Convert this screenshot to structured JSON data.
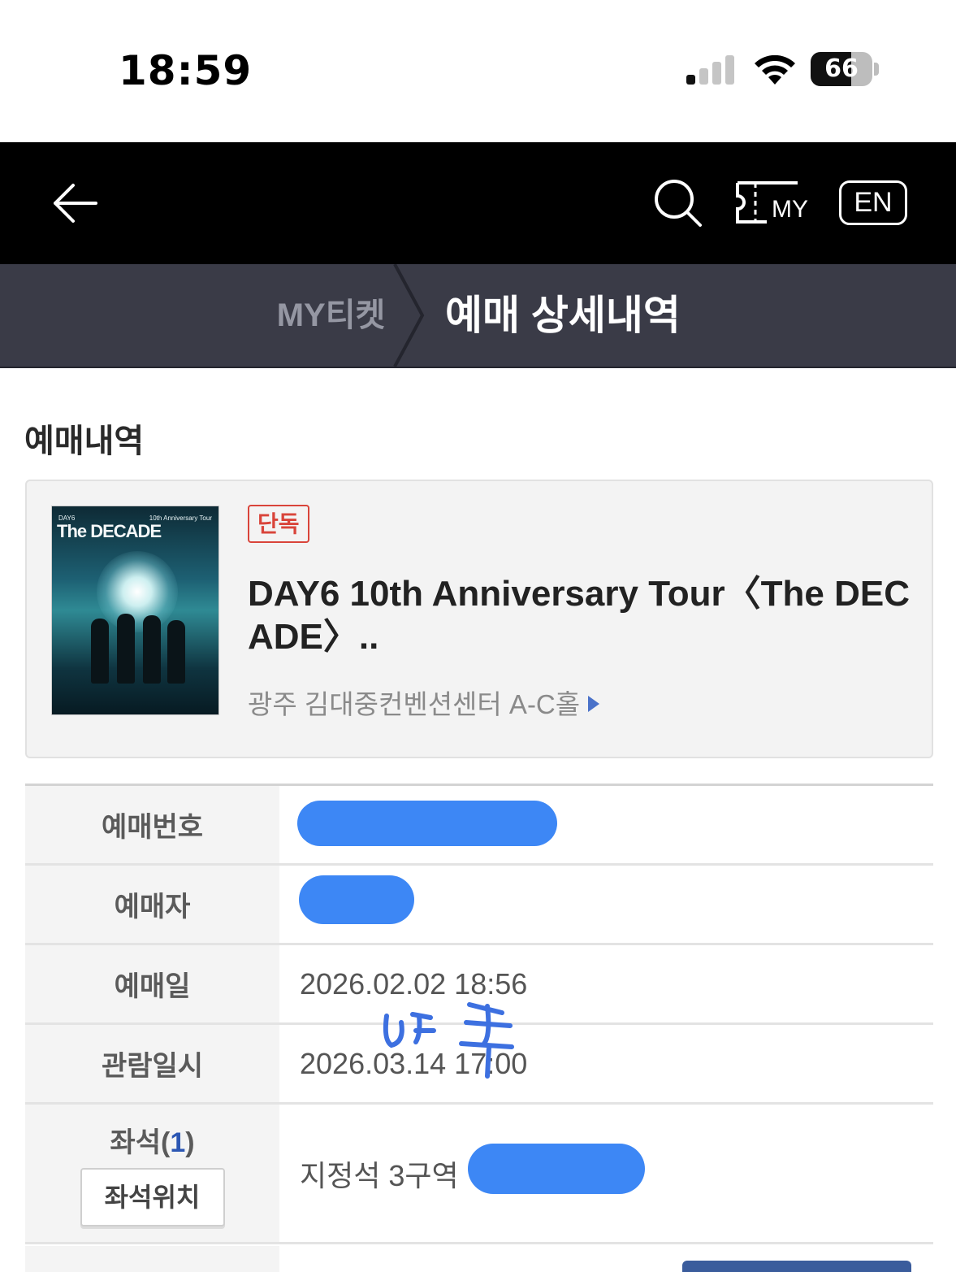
{
  "status_bar": {
    "time": "18:59",
    "battery_percent": "66",
    "battery_level": 0.66,
    "signal_bars_active": 1,
    "icons": [
      "cellular-signal-icon",
      "wifi-icon",
      "battery-icon"
    ]
  },
  "nav": {
    "back_icon": "arrow-left-icon",
    "search_icon": "search-icon",
    "my_ticket_label": "MY",
    "my_ticket_icon": "ticket-icon",
    "language_label": "EN"
  },
  "breadcrumb": {
    "parent": "MY티켓",
    "current": "예매 상세내역"
  },
  "section_title": "예매내역",
  "booking": {
    "badge": "단독",
    "title": "DAY6 10th Anniversary Tour〈The DECADE〉..",
    "venue": "광주 김대중컨벤션센터 A-C홀",
    "poster": {
      "brand": "DAY6",
      "subtitle": "10th Anniversary Tour",
      "title": "The DECADE"
    }
  },
  "details": {
    "booking_number_label": "예매번호",
    "booker_label": "예매자",
    "booking_date_label": "예매일",
    "booking_date_value": "2026.02.02 18:56",
    "view_datetime_label": "관람일시",
    "view_datetime_value": "2026.03.14 17:00",
    "seat_label": "좌석",
    "seat_count_open": "(",
    "seat_count": "1",
    "seat_count_close": ")",
    "seat_location_button": "좌석위치",
    "seat_value": "지정석 3구역"
  },
  "colors": {
    "nav_bg": "#000000",
    "breadcrumb_bg": "#3a3b47",
    "badge_red": "#d9443a",
    "redaction_blue": "#3d87f5",
    "accent_blue": "#2b56b3"
  }
}
